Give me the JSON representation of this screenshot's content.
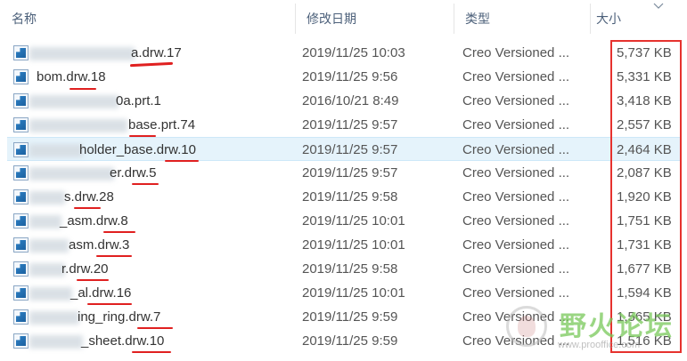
{
  "columns": {
    "name": "名称",
    "date": "修改日期",
    "type": "类型",
    "size": "大小"
  },
  "sort_icon": "chevron-down-icon",
  "file_icon": "creo-file-icon",
  "rows": [
    {
      "name": "a.drw.17",
      "date": "2019/11/25 10:03",
      "type": "Creo Versioned ...",
      "size": "5,737 KB"
    },
    {
      "name": "bom.drw.18",
      "date": "2019/11/25 9:56",
      "type": "Creo Versioned ...",
      "size": "5,331 KB"
    },
    {
      "name": "0a.prt.1",
      "date": "2016/10/21 8:49",
      "type": "Creo Versioned ...",
      "size": "3,418 KB"
    },
    {
      "name": "base.prt.74",
      "date": "2019/11/25 9:57",
      "type": "Creo Versioned ...",
      "size": "2,557 KB"
    },
    {
      "name": "holder_base.drw.10",
      "date": "2019/11/25 9:57",
      "type": "Creo Versioned ...",
      "size": "2,464 KB"
    },
    {
      "name": "er.drw.5",
      "date": "2019/11/25 9:57",
      "type": "Creo Versioned ...",
      "size": "2,087 KB"
    },
    {
      "name": "s.drw.28",
      "date": "2019/11/25 9:58",
      "type": "Creo Versioned ...",
      "size": "1,920 KB"
    },
    {
      "name": "_asm.drw.8",
      "date": "2019/11/25 10:01",
      "type": "Creo Versioned ...",
      "size": "1,751 KB"
    },
    {
      "name": "asm.drw.3",
      "date": "2019/11/25 10:01",
      "type": "Creo Versioned ...",
      "size": "1,731 KB"
    },
    {
      "name": "r.drw.20",
      "date": "2019/11/25 9:58",
      "type": "Creo Versioned ...",
      "size": "1,677 KB"
    },
    {
      "name": "_al.drw.16",
      "date": "2019/11/25 10:01",
      "type": "Creo Versioned ...",
      "size": "1,594 KB"
    },
    {
      "name": "ing_ring.drw.7",
      "date": "2019/11/25 9:59",
      "type": "Creo Versioned ...",
      "size": "1,565 KB"
    },
    {
      "name": "_sheet.drw.10",
      "date": "2019/11/25 9:59",
      "type": "Creo Versioned ...",
      "size": "1,516 KB"
    }
  ],
  "watermark": {
    "text": "野火论坛",
    "url": "www.prooffice.com"
  },
  "annotation_color": "#e6322e"
}
